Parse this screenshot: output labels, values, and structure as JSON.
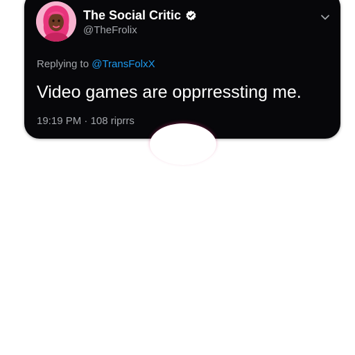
{
  "tweet": {
    "display_name": "The Social Critic",
    "handle": "@TheFrolix",
    "reply_prefix": "Replying to",
    "reply_handle": "@TransFolxX",
    "text": "Video games are opprressting me.",
    "timestamp": "19:19 PM",
    "separator": "·",
    "stats": "108 riprrs"
  },
  "icons": {
    "verified": "verified-badge-icon",
    "menu": "chevron-down-icon",
    "avatar": "avatar-illustration"
  },
  "colors": {
    "card_background": "#07070a",
    "primary_text": "#ffffff",
    "secondary_text": "#a3a6ab",
    "link": "#1d9bf0",
    "avatar_background": "#f7b3cf"
  }
}
